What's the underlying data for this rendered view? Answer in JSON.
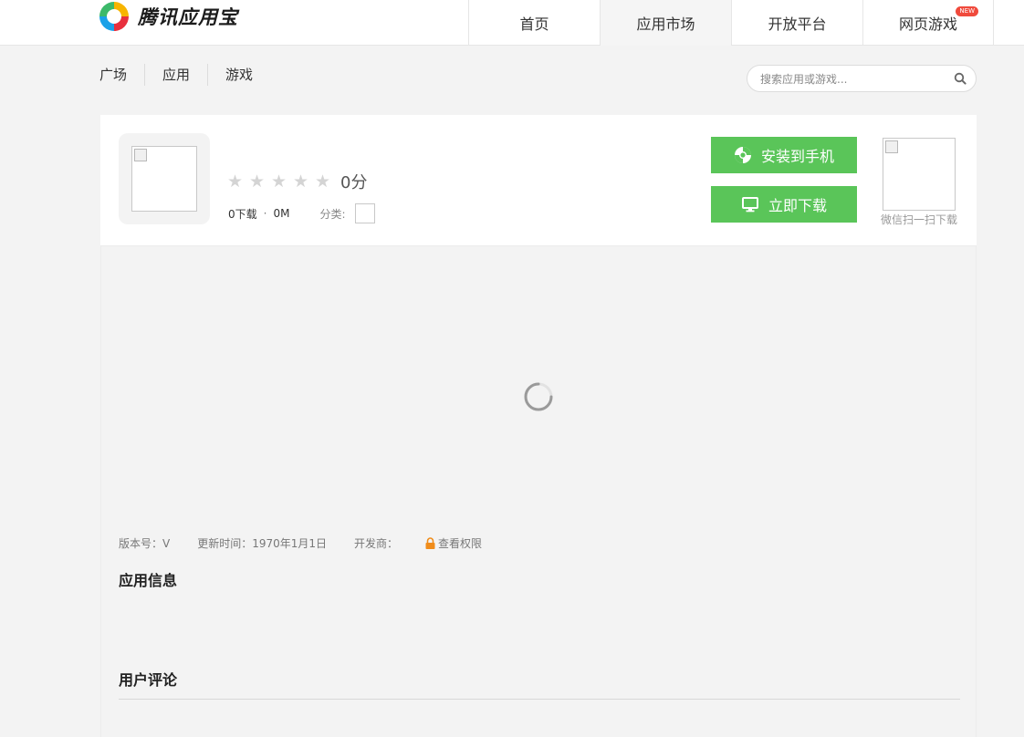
{
  "header": {
    "logo_text": "腾讯应用宝",
    "nav": [
      {
        "label": "首页"
      },
      {
        "label": "应用市场"
      },
      {
        "label": "开放平台"
      },
      {
        "label": "网页游戏",
        "badge": "NEW"
      }
    ]
  },
  "subnav": {
    "items": [
      {
        "label": "广场"
      },
      {
        "label": "应用"
      },
      {
        "label": "游戏"
      }
    ]
  },
  "search": {
    "placeholder": "搜索应用或游戏...",
    "value": ""
  },
  "app": {
    "rating": 0,
    "score_text": "0分",
    "downloads": "0下载",
    "separator": "·",
    "size": "0M",
    "category_label": "分类:",
    "install_label": "安装到手机",
    "download_label": "立即下载",
    "qr_label": "微信扫一扫下载"
  },
  "details": {
    "version": "版本号：V",
    "updated": "更新时间：1970年1月1日",
    "developer": "开发商：",
    "permission": "查看权限"
  },
  "sections": {
    "info_title": "应用信息",
    "review_title": "用户评论"
  },
  "colors": {
    "accent_green": "#5ac559",
    "badge_red": "#f04a3c",
    "lock_orange": "#f08c1a"
  }
}
